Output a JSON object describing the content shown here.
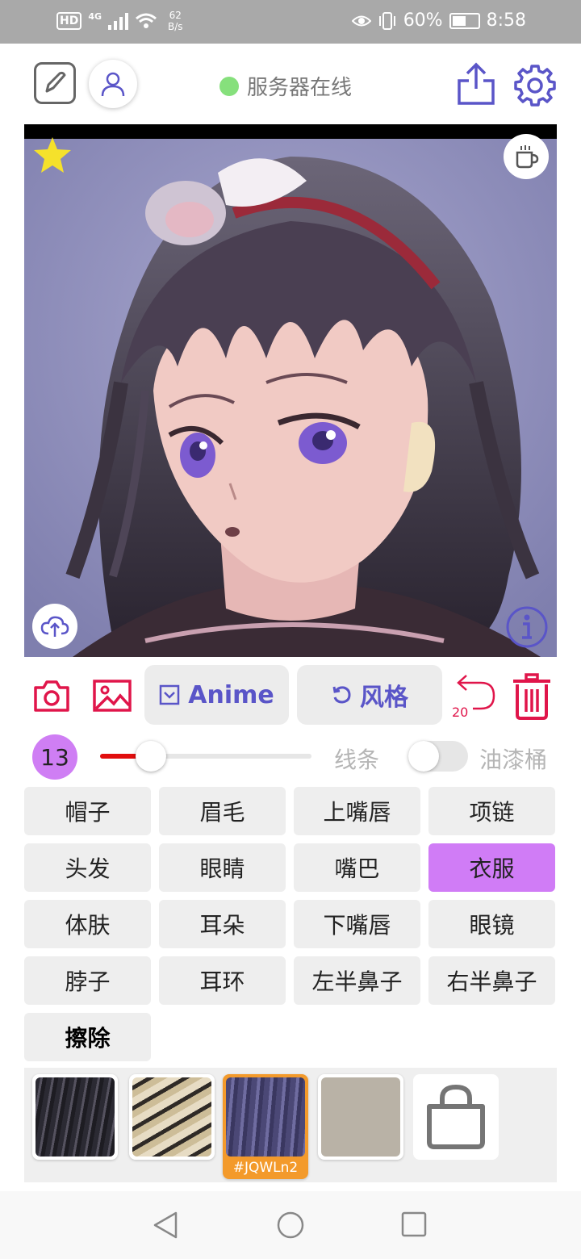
{
  "status_bar": {
    "hd": "HD",
    "network": "4G",
    "speed_value": "62",
    "speed_unit": "B/s",
    "battery": "60%",
    "time": "8:58"
  },
  "header": {
    "server_status": "服务器在线",
    "status_color": "#86e07c"
  },
  "toolbar": {
    "mode_label": "Anime",
    "style_label": "风格",
    "undo_count": "20"
  },
  "brush": {
    "size": "13",
    "line_label": "线条",
    "bucket_label": "油漆桶",
    "slider_fraction": 0.24,
    "bucket_enabled": false
  },
  "parts": [
    {
      "label": "帽子",
      "selected": false
    },
    {
      "label": "眉毛",
      "selected": false
    },
    {
      "label": "上嘴唇",
      "selected": false
    },
    {
      "label": "项链",
      "selected": false
    },
    {
      "label": "头发",
      "selected": false
    },
    {
      "label": "眼睛",
      "selected": false
    },
    {
      "label": "嘴巴",
      "selected": false
    },
    {
      "label": "衣服",
      "selected": true
    },
    {
      "label": "体肤",
      "selected": false
    },
    {
      "label": "耳朵",
      "selected": false
    },
    {
      "label": "下嘴唇",
      "selected": false
    },
    {
      "label": "眼镜",
      "selected": false
    },
    {
      "label": "脖子",
      "selected": false
    },
    {
      "label": "耳环",
      "selected": false
    },
    {
      "label": "左半鼻子",
      "selected": false
    },
    {
      "label": "右半鼻子",
      "selected": false
    },
    {
      "label": "擦除",
      "selected": false
    }
  ],
  "swatches": {
    "selected_code": "#JQWLn2"
  },
  "colors": {
    "accent_purple": "#5a55c8",
    "accent_red": "#e0154a",
    "selected_part": "#d07cf6",
    "swatch_selected_border": "#f39a2b"
  },
  "icons": {
    "edit": "edit-pen-icon",
    "profile": "user-icon",
    "share": "share-icon",
    "settings": "gear-icon",
    "favorite": "star-icon",
    "coffee": "coffee-cup-icon",
    "upload": "cloud-upload-icon",
    "info": "info-icon",
    "camera": "camera-icon",
    "gallery": "image-icon",
    "undo": "undo-icon",
    "delete": "trash-icon",
    "shop": "shopping-bag-icon"
  }
}
